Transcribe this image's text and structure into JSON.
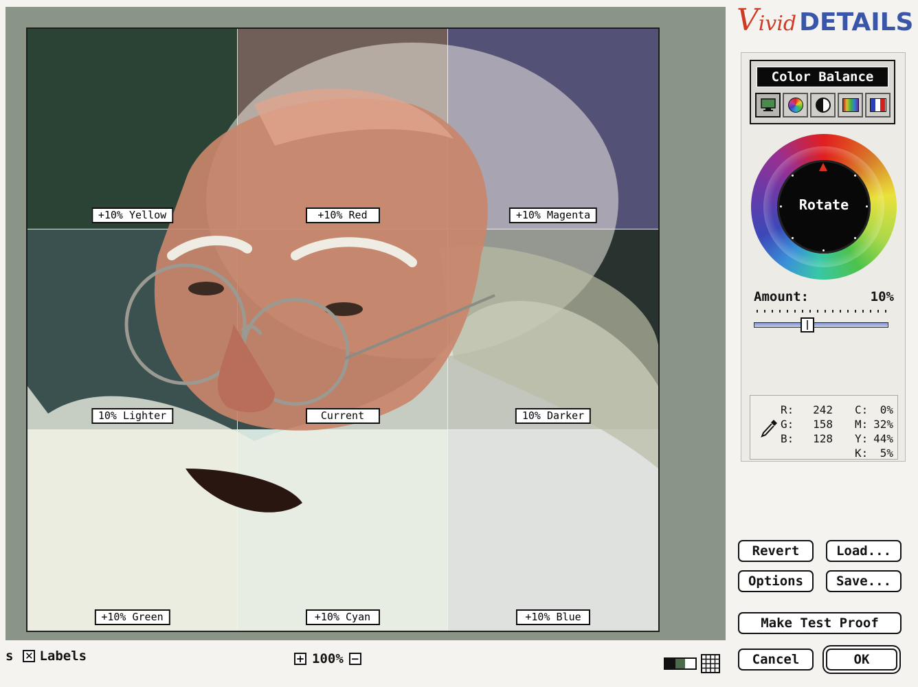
{
  "preview": {
    "cells": [
      {
        "label": "+10% Yellow",
        "tint": "#2b4334"
      },
      {
        "label": "+10% Red",
        "tint": "#6f5f58"
      },
      {
        "label": "+10% Magenta",
        "tint": "#545176"
      },
      {
        "label": "10% Lighter",
        "tint": "#3a5150"
      },
      {
        "label": "Current",
        "tint": "#3b4d4a"
      },
      {
        "label": "10% Darker",
        "tint": "#28332f"
      },
      {
        "label": "+10% Green",
        "tint": "#dce3cd"
      },
      {
        "label": "+10% Cyan",
        "tint": "#d3e4de"
      },
      {
        "label": "+10% Blue",
        "tint": "#a7aecd"
      }
    ]
  },
  "bottom_bar": {
    "labels_prefix": "s",
    "labels_checked": "✕",
    "labels_text": "Labels",
    "zoom_in": "+",
    "zoom_level": "100%",
    "zoom_out": "−"
  },
  "logo": {
    "v": "V",
    "ivid": "ivid",
    "details": "DETAILS"
  },
  "panel": {
    "mode_title": "Color Balance",
    "mode_icons": [
      "monitor-icon",
      "color-wheel-icon",
      "contrast-icon",
      "spectrum-icon",
      "color-bars-icon"
    ],
    "wheel_label": "Rotate",
    "amount_label": "Amount:",
    "amount_value": "10%",
    "amount_fraction": 0.4
  },
  "readout": {
    "rgb": [
      {
        "k": "R:",
        "v": "242"
      },
      {
        "k": "G:",
        "v": "158"
      },
      {
        "k": "B:",
        "v": "128"
      }
    ],
    "cmyk": [
      {
        "k": "C:",
        "v": "0%"
      },
      {
        "k": "M:",
        "v": "32%"
      },
      {
        "k": "Y:",
        "v": "44%"
      },
      {
        "k": "K:",
        "v": "5%"
      }
    ]
  },
  "buttons": {
    "revert": "Revert",
    "load": "Load...",
    "options": "Options",
    "save": "Save...",
    "test_proof": "Make Test Proof",
    "cancel": "Cancel",
    "ok": "OK"
  },
  "colors": {
    "frame": "#8a9487",
    "logo_red": "#cf3a25",
    "logo_blue": "#3a56a8"
  }
}
